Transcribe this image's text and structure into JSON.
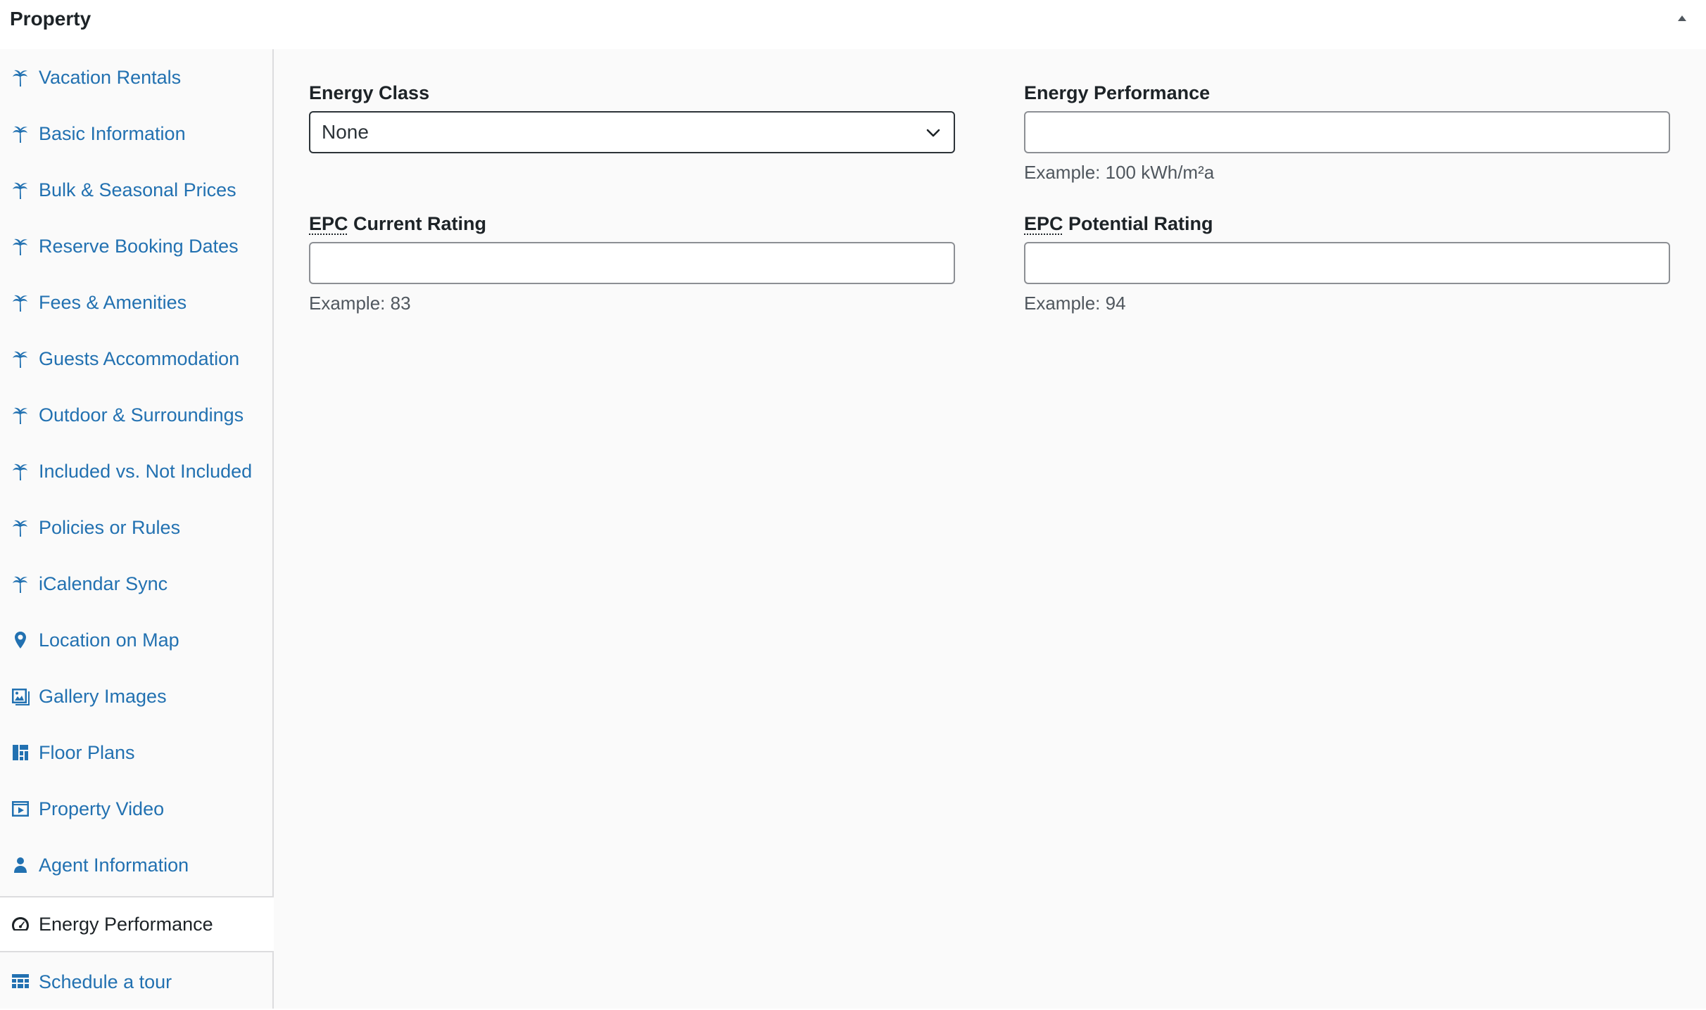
{
  "header": {
    "title": "Property",
    "toggle_icon": "triangle-up-icon"
  },
  "sidebar": {
    "items": [
      {
        "label": "Vacation Rentals",
        "icon": "palm-tree-icon"
      },
      {
        "label": "Basic Information",
        "icon": "palm-tree-icon"
      },
      {
        "label": "Bulk & Seasonal Prices",
        "icon": "palm-tree-icon"
      },
      {
        "label": "Reserve Booking Dates",
        "icon": "palm-tree-icon"
      },
      {
        "label": "Fees & Amenities",
        "icon": "palm-tree-icon"
      },
      {
        "label": "Guests Accommodation",
        "icon": "palm-tree-icon"
      },
      {
        "label": "Outdoor & Surroundings",
        "icon": "palm-tree-icon"
      },
      {
        "label": "Included vs. Not Included",
        "icon": "palm-tree-icon"
      },
      {
        "label": "Policies or Rules",
        "icon": "palm-tree-icon"
      },
      {
        "label": "iCalendar Sync",
        "icon": "palm-tree-icon"
      },
      {
        "label": "Location on Map",
        "icon": "location-pin-icon"
      },
      {
        "label": "Gallery Images",
        "icon": "gallery-icon"
      },
      {
        "label": "Floor Plans",
        "icon": "floor-plan-icon"
      },
      {
        "label": "Property Video",
        "icon": "video-icon"
      },
      {
        "label": "Agent Information",
        "icon": "person-icon"
      },
      {
        "label": "Energy Performance",
        "icon": "gauge-icon",
        "active": true
      },
      {
        "label": "Schedule a tour",
        "icon": "calendar-grid-icon"
      }
    ]
  },
  "form": {
    "energy_class": {
      "label": "Energy Class",
      "selected": "None"
    },
    "energy_performance": {
      "label": "Energy Performance",
      "value": "",
      "hint": "Example: 100 kWh/m²a"
    },
    "epc_current": {
      "label_abbr": "EPC",
      "label_rest": " Current Rating",
      "value": "",
      "hint": "Example: 83"
    },
    "epc_potential": {
      "label_abbr": "EPC",
      "label_rest": " Potential Rating",
      "value": "",
      "hint": "Example: 94"
    }
  },
  "colors": {
    "link": "#2271b1",
    "text": "#1d2327",
    "hint": "#50575e",
    "border": "#dcdcde"
  }
}
